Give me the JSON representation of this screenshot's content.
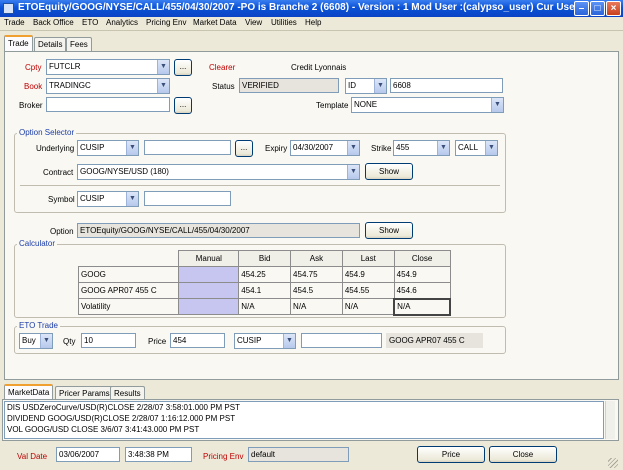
{
  "window": {
    "title": "ETOEquity/GOOG/NYSE/CALL/455/04/30/2007  -PO is Branche 2  (6608) - Version : 1 Mod User :(calypso_user) Cur Use..."
  },
  "menu": [
    "Trade",
    "Back Office",
    "ETO",
    "Analytics",
    "Pricing Env",
    "Market Data",
    "View",
    "Utilities",
    "Help"
  ],
  "tabs": [
    "Trade",
    "Details",
    "Fees"
  ],
  "trade": {
    "cpty_label": "Cpty",
    "cpty_value": "FUTCLR",
    "clearer_label": "Clearer",
    "clearer_value": "Credit Lyonnais",
    "book_label": "Book",
    "book_value": "TRADINGC",
    "status_label": "Status",
    "status_value": "VERIFIED",
    "id_type": "ID",
    "id_value": "6608",
    "broker_label": "Broker",
    "broker_value": "",
    "template_label": "Template",
    "template_value": "NONE",
    "ellipsis": "..."
  },
  "option_selector": {
    "title": "Option Selector",
    "underlying_label": "Underlying",
    "underlying_type": "CUSIP",
    "underlying_value": "",
    "expiry_label": "Expiry",
    "expiry_value": "04/30/2007",
    "strike_label": "Strike",
    "strike_value": "455",
    "option_type": "CALL",
    "contract_label": "Contract",
    "contract_value": "GOOG/NYSE/USD (180)",
    "show_label": "Show",
    "symbol_label": "Symbol",
    "symbol_type": "CUSIP",
    "symbol_value": ""
  },
  "option": {
    "label": "Option",
    "value": "ETOEquity/GOOG/NYSE/CALL/455/04/30/2007",
    "show_label": "Show"
  },
  "calculator": {
    "title": "Calculator",
    "headers": [
      "",
      "Manual",
      "Bid",
      "Ask",
      "Last",
      "Close"
    ],
    "rows": [
      [
        "GOOG",
        "",
        "454.25",
        "454.75",
        "454.9",
        "454.9"
      ],
      [
        "GOOG APR07 455 C",
        "",
        "454.1",
        "454.5",
        "454.55",
        "454.6"
      ],
      [
        "Volatility",
        "",
        "N/A",
        "N/A",
        "N/A",
        "N/A"
      ]
    ]
  },
  "eto_trade": {
    "title": "ETO Trade",
    "side": "Buy",
    "qty_label": "Qty",
    "qty_value": "10",
    "price_label": "Price",
    "price_value": "454",
    "id_type": "CUSIP",
    "id_value": "",
    "description": "GOOG APR07 455 C"
  },
  "bottom_tabs": [
    "MarketData",
    "Pricer Params",
    "Results"
  ],
  "market_data": [
    "DIS  USDZeroCurve/USD(R)CLOSE 2/28/07 3:58:01.000 PM PST",
    "DIVIDEND  GOOG/USD(R)CLOSE 2/28/07 1:16:12.000 PM PST",
    "VOL  GOOG/USD CLOSE 3/6/07 3:41:43.000 PM PST"
  ],
  "footer": {
    "valdate_label": "Val Date",
    "valdate_value": "03/06/2007",
    "time_value": "3:48:38 PM",
    "pricing_env_label": "Pricing Env",
    "pricing_env_value": "default",
    "price_button": "Price",
    "close_button": "Close"
  }
}
